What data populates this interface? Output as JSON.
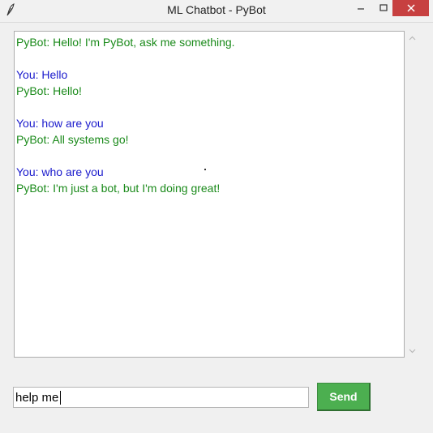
{
  "window": {
    "title": "ML Chatbot - PyBot",
    "icon": "feather-icon",
    "controls": [
      "minimize-icon",
      "maximize-icon",
      "close-icon"
    ]
  },
  "chat": {
    "messages": [
      {
        "speaker": "bot",
        "text": "PyBot: Hello! I'm PyBot, ask me something."
      },
      {
        "speaker": "blank",
        "text": ""
      },
      {
        "speaker": "user",
        "text": "You: Hello"
      },
      {
        "speaker": "bot",
        "text": "PyBot: Hello!"
      },
      {
        "speaker": "blank",
        "text": ""
      },
      {
        "speaker": "user",
        "text": "You: how are you"
      },
      {
        "speaker": "bot",
        "text": "PyBot: All systems go!"
      },
      {
        "speaker": "blank",
        "text": ""
      },
      {
        "speaker": "user",
        "text": "You: who are you"
      },
      {
        "speaker": "bot",
        "text": "PyBot: I'm just a bot, but I'm doing great!"
      }
    ],
    "colors": {
      "bot": "#1a8a1a",
      "user": "#1a1acc"
    }
  },
  "input": {
    "value": "help me"
  },
  "send_button": {
    "label": "Send",
    "color": "#4caf50"
  }
}
